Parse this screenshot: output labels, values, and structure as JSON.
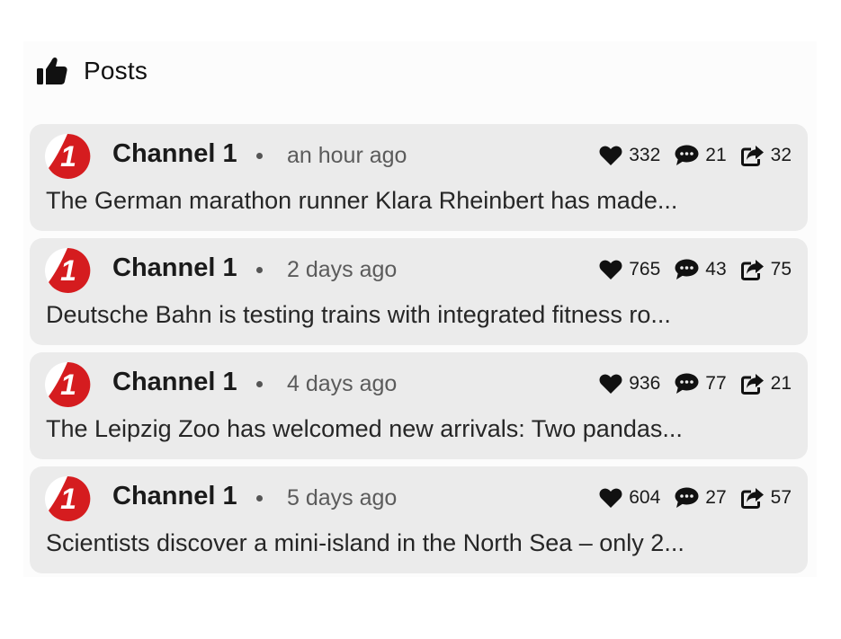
{
  "header": {
    "title": "Posts",
    "icon": "thumbs-up-icon"
  },
  "colors": {
    "card_bg": "#ebebeb",
    "logo_red": "#d51c1f",
    "text": "#1f1f1f",
    "muted": "#5b5b5b"
  },
  "posts": [
    {
      "channel": "Channel 1",
      "logo_text": "1",
      "time": "an hour ago",
      "likes": "332",
      "comments": "21",
      "shares": "32",
      "text": "The German marathon runner Klara Rheinbert has made..."
    },
    {
      "channel": "Channel 1",
      "logo_text": "1",
      "time": "2 days ago",
      "likes": "765",
      "comments": "43",
      "shares": "75",
      "text": "Deutsche Bahn is testing trains with integrated fitness ro..."
    },
    {
      "channel": "Channel 1",
      "logo_text": "1",
      "time": "4 days ago",
      "likes": "936",
      "comments": "77",
      "shares": "21",
      "text": "The Leipzig Zoo has welcomed new arrivals: Two pandas..."
    },
    {
      "channel": "Channel 1",
      "logo_text": "1",
      "time": "5 days ago",
      "likes": "604",
      "comments": "27",
      "shares": "57",
      "text": "Scientists discover a mini-island in the North Sea – only 2..."
    }
  ]
}
